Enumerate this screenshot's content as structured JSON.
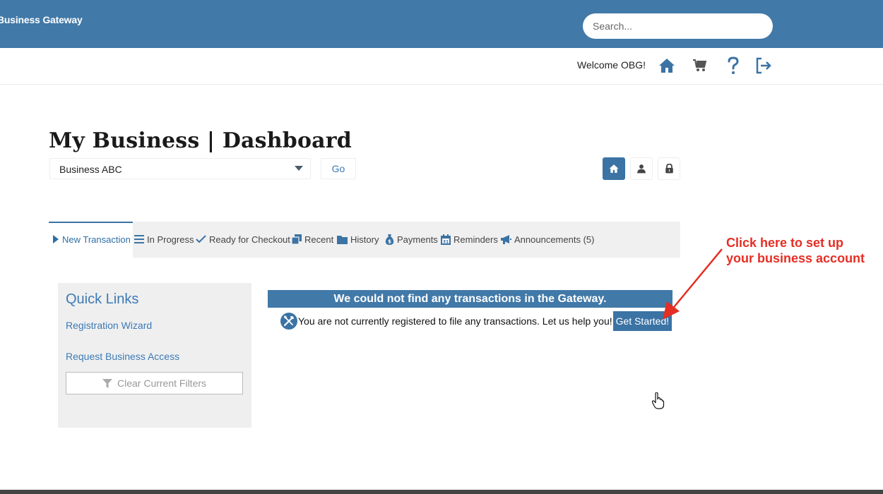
{
  "header": {
    "brand": "Business Gateway",
    "search_placeholder": "Search..."
  },
  "subheader": {
    "welcome": "Welcome OBG!",
    "icons": [
      "home-icon",
      "cart-icon",
      "help-icon",
      "logout-icon"
    ]
  },
  "page": {
    "title": "My Business | Dashboard",
    "business_select": "Business ABC",
    "go_label": "Go",
    "view_buttons": [
      "home-icon",
      "user-icon",
      "lock-icon"
    ]
  },
  "tabs": [
    {
      "label": "New Transaction",
      "icon": "caret-right-icon",
      "active": true
    },
    {
      "label": "In Progress",
      "icon": "list-icon"
    },
    {
      "label": "Ready for Checkout",
      "icon": "check-icon"
    },
    {
      "label": "Recent",
      "icon": "copy-icon"
    },
    {
      "label": "History",
      "icon": "folder-icon"
    },
    {
      "label": "Payments",
      "icon": "money-bag-icon"
    },
    {
      "label": "Reminders",
      "icon": "calendar-icon"
    },
    {
      "label": "Announcements (5)",
      "icon": "megaphone-icon"
    }
  ],
  "quick_links": {
    "title": "Quick Links",
    "links": [
      "Registration Wizard",
      "Request Business Access"
    ],
    "clear_filters": "Clear Current Filters"
  },
  "main": {
    "banner": "We could not find any transactions in the Gateway.",
    "message": "You are not currently registered to file any transactions. Let us help you!",
    "get_started": "Get Started!"
  },
  "annotation": {
    "line1": "Click here to set up",
    "line2": "your business account"
  },
  "colors": {
    "brand_blue": "#4179a8",
    "accent_blue": "#3b73a4",
    "annotation_red": "#e52e24"
  }
}
